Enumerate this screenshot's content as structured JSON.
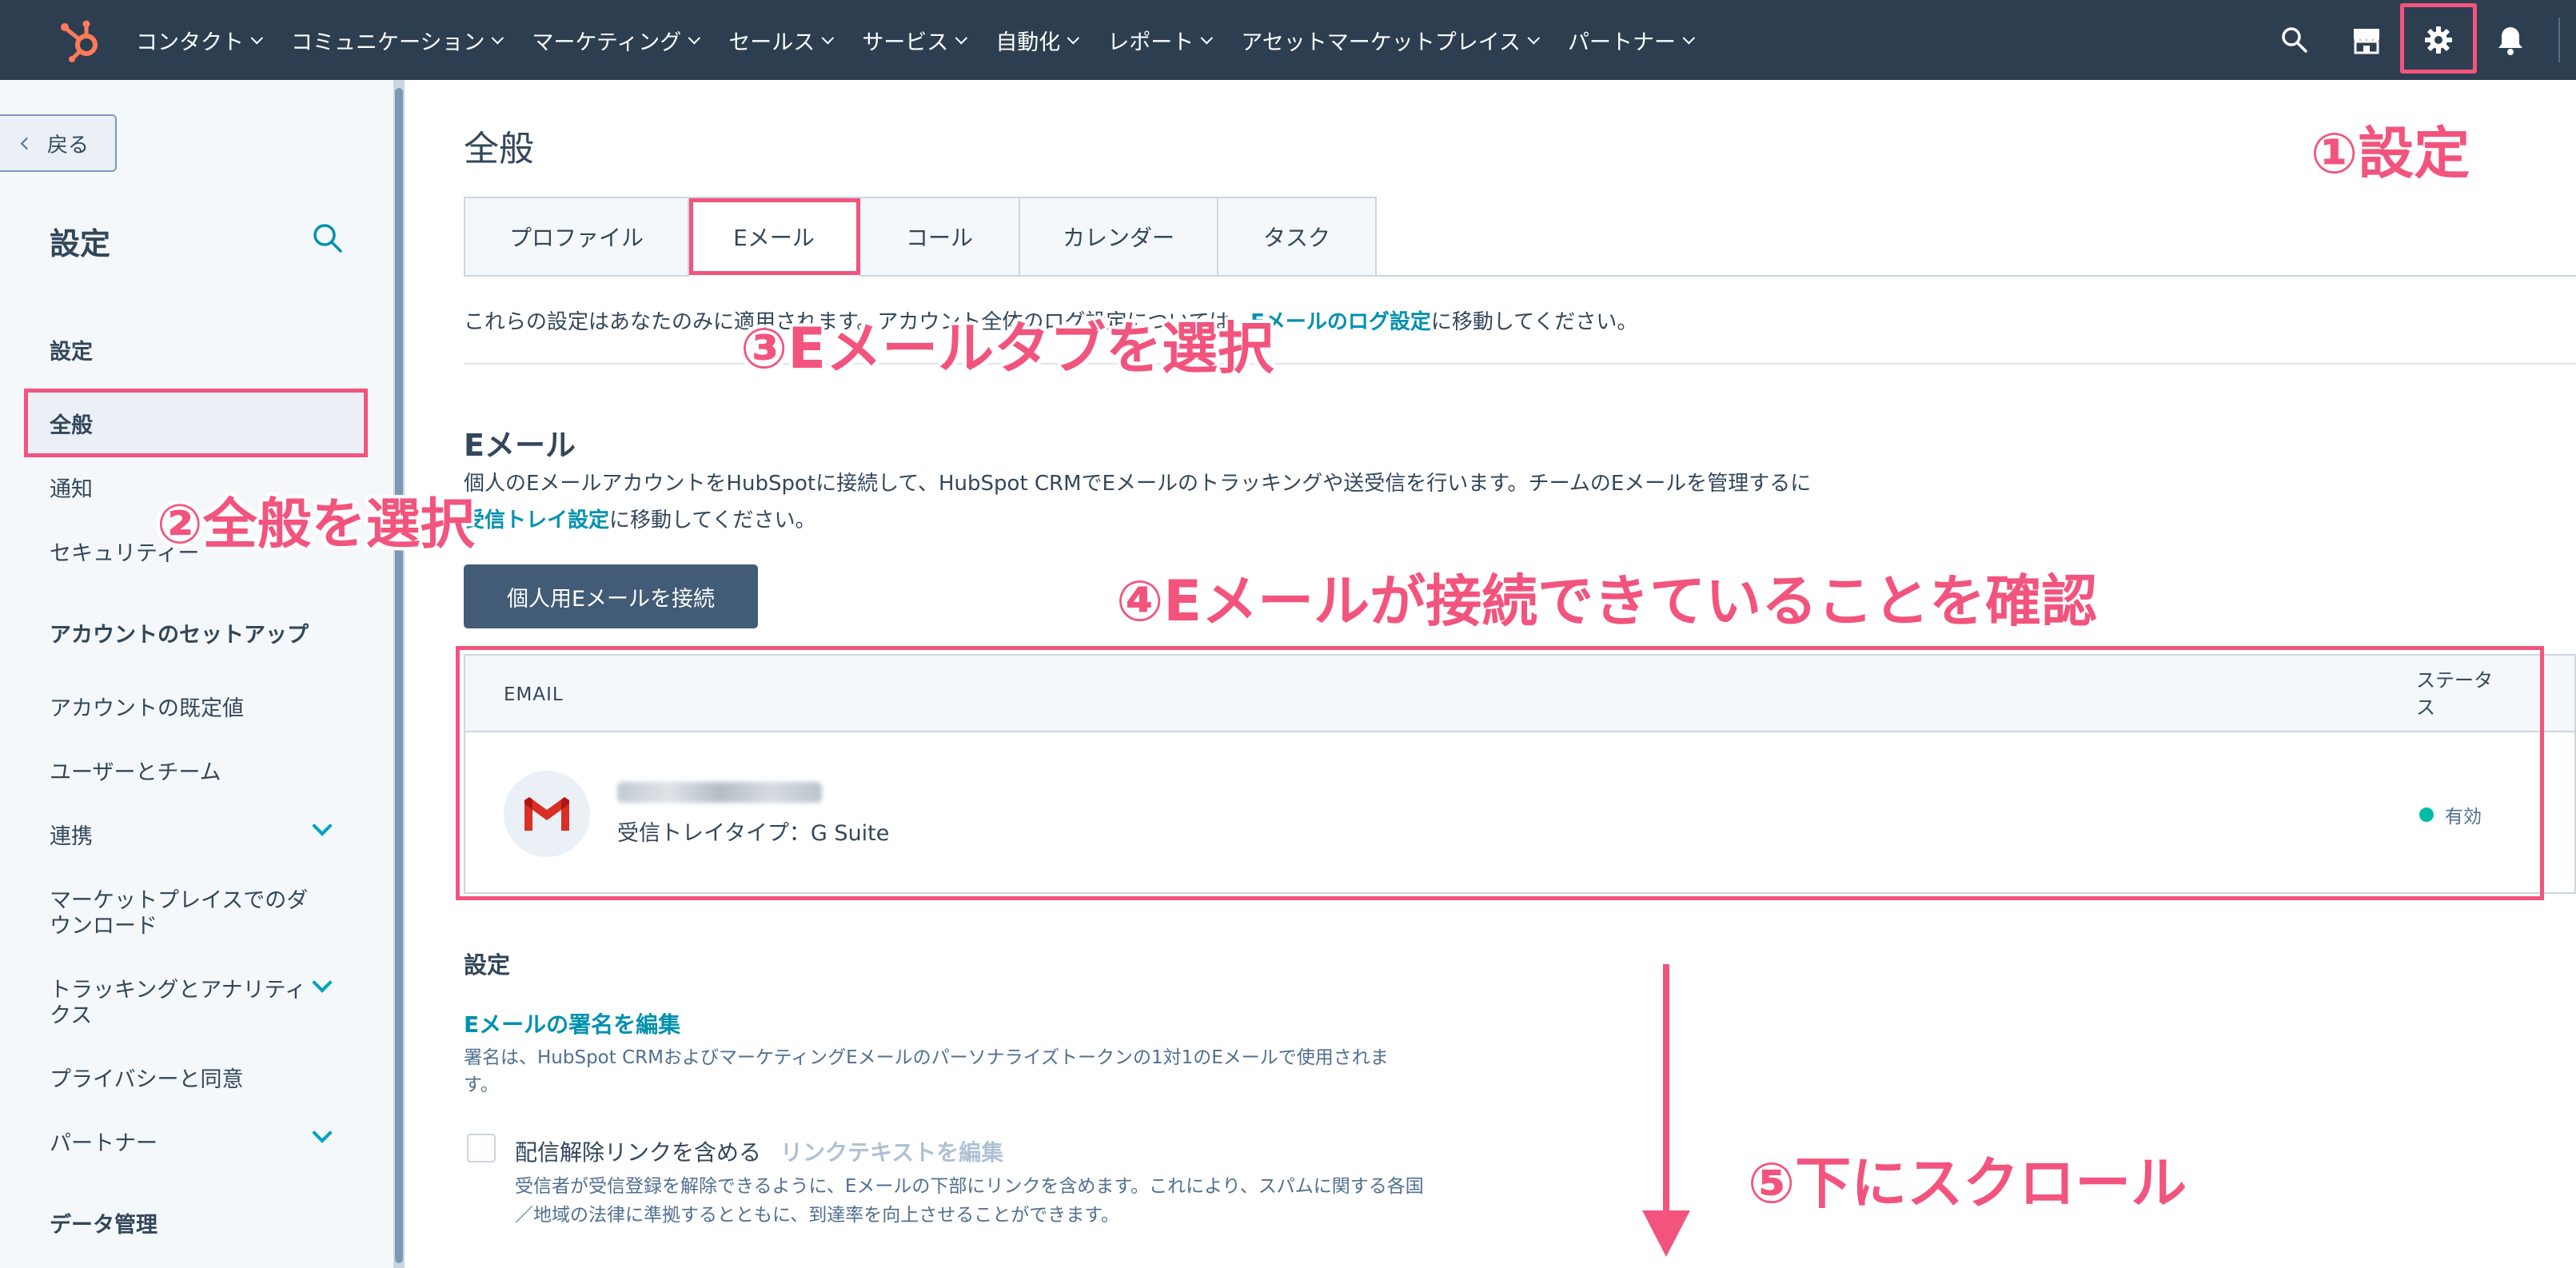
{
  "topnav": {
    "items": [
      {
        "label": "コンタクト"
      },
      {
        "label": "コミュニケーション"
      },
      {
        "label": "マーケティング"
      },
      {
        "label": "セールス"
      },
      {
        "label": "サービス"
      },
      {
        "label": "自動化"
      },
      {
        "label": "レポート"
      },
      {
        "label": "アセットマーケットプレイス"
      },
      {
        "label": "パートナー"
      }
    ],
    "background": "#2d3e50",
    "brand_color": "#ff7a59",
    "icons": [
      "hubspot-logo-icon",
      "search-icon",
      "marketplace-icon",
      "gear-icon",
      "bell-icon"
    ]
  },
  "sidebar": {
    "back_label": "戻る",
    "title": "設定",
    "items": {
      "settings_heading": "設定",
      "general": "全般",
      "notifications": "通知",
      "security": "セキュリティー",
      "account_setup_heading": "アカウントのセットアップ",
      "account_defaults": "アカウントの既定値",
      "users_teams": "ユーザーとチーム",
      "integrations": "連携",
      "marketplace_downloads_1": "マーケットプレイスでのダ",
      "marketplace_downloads_2": "ウンロード",
      "tracking_1": "トラッキングとアナリティ",
      "tracking_2": "クス",
      "privacy": "プライバシーと同意",
      "partner": "パートナー",
      "data_management_heading": "データ管理"
    }
  },
  "main": {
    "page_title": "全般",
    "tabs": [
      {
        "label": "プロファイル"
      },
      {
        "label": "Eメール"
      },
      {
        "label": "コール"
      },
      {
        "label": "カレンダー"
      },
      {
        "label": "タスク"
      }
    ],
    "notice_prefix": "これらの設定はあなたのみに適用されます。アカウント全体のログ設定については、",
    "notice_link": "Eメールのログ設定",
    "notice_suffix": "に移動してください。",
    "email_section": {
      "title": "Eメール",
      "desc_line1": "個人のEメールアカウントをHubSpotに接続して、HubSpot CRMでEメールのトラッキングや送受信を行います。チームのEメールを管理するに",
      "desc_link": "受信トレイ設定",
      "desc_suffix": "に移動してください。",
      "connect_button": "個人用Eメールを接続",
      "table": {
        "col_email": "EMAIL",
        "col_status_1": "ステータ",
        "col_status_2": "ス",
        "row": {
          "inbox_type": "受信トレイタイプ：G Suite",
          "status": "有効",
          "status_color": "#00bda5"
        }
      }
    },
    "settings_section": {
      "title": "設定",
      "signature_link": "Eメールの署名を編集",
      "signature_desc": "署名は、HubSpot CRMおよびマーケティングEメールのパーソナライズトークンの1対1のEメールで使用されます。",
      "unsub_label": "配信解除リンクを含める",
      "unsub_link": "リンクテキストを編集",
      "unsub_checked": false,
      "unsub_desc": "受信者が受信登録を解除できるように、Eメールの下部にリンクを含めます。これにより、スパムに関する各国／地域の法律に準拠するとともに、到達率を向上させることができます。"
    }
  },
  "annotations": {
    "step1": "①設定",
    "step2": "②全般を選択",
    "step3": "③Eメールタブを選択",
    "step4": "④Eメールが接続できていることを確認",
    "step5": "⑤下にスクロール",
    "color": "#f2547d"
  }
}
